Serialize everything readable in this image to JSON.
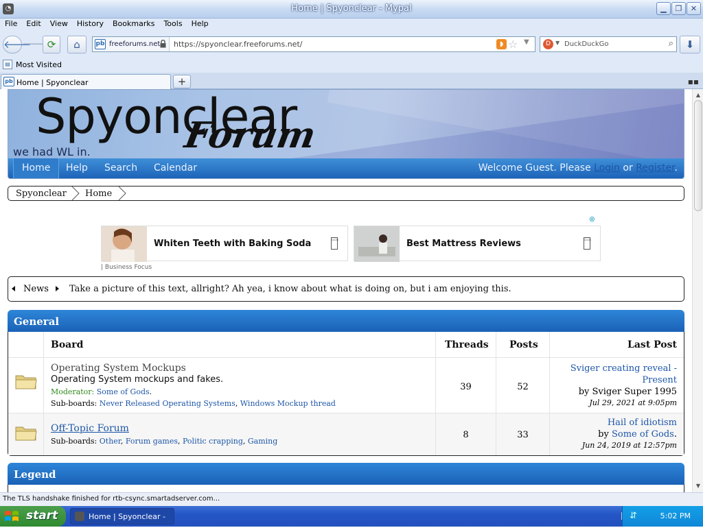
{
  "window": {
    "title": "Home | Spyonclear - Mypal",
    "controls": [
      "minimize",
      "restore",
      "close"
    ]
  },
  "menu": [
    "File",
    "Edit",
    "View",
    "History",
    "Bookmarks",
    "Tools",
    "Help"
  ],
  "toolbar": {
    "site_identity": "freeforums.net",
    "url": "https://spyonclear.freeforums.net/",
    "search_placeholder": "DuckDuckGo"
  },
  "bookmarks": {
    "item": "Most Visited"
  },
  "tabs": [
    {
      "label": "Home | Spyonclear"
    }
  ],
  "banner": {
    "logo": "Spyonclear",
    "logo_sub": "Forum",
    "tagline": "we had WL in.",
    "nav": [
      "Home",
      "Help",
      "Search",
      "Calendar"
    ],
    "welcome_prefix": "Welcome Guest. Please",
    "login": "Login",
    "or": "or",
    "register": "Register",
    "period": "."
  },
  "breadcrumb": [
    "Spyonclear",
    "Home"
  ],
  "ads": [
    {
      "title": "Whiten Teeth with Baking Soda"
    },
    {
      "title": "Best Mattress Reviews"
    }
  ],
  "ads_source": "| Business Focus",
  "news": {
    "label": "News",
    "text": "Take a picture of this text, allright? Ah yea, i know about what is doing on, but i am enjoying this."
  },
  "categories": {
    "general": {
      "title": "General",
      "headers": {
        "board": "Board",
        "threads": "Threads",
        "posts": "Posts",
        "last_post": "Last Post"
      },
      "boards": [
        {
          "name": "Operating System Mockups",
          "description": "Operating System mockups and fakes.",
          "moderator_label": "Moderator:",
          "moderator": "Some of Gods",
          "subboards_label": "Sub-boards:",
          "subboards": [
            "Never Released Operating Systems",
            "Windows Mockup thread"
          ],
          "threads": "39",
          "posts": "52",
          "last_post_title": "Sviger creating reveal - Present",
          "last_post_title_1": "Sviger creating reveal -",
          "last_post_title_2": "Present",
          "last_post_by": "by Sviger Super 1995",
          "last_post_date": "Jul 29, 2021 at 9:05pm"
        },
        {
          "name": "Off-Topic Forum",
          "subboards_label": "Sub-boards:",
          "subboards": [
            "Other",
            "Forum games",
            "Politic crapping",
            "Gaming"
          ],
          "threads": "8",
          "posts": "33",
          "last_post_title": "Hail of idiotism",
          "last_post_by_prefix": "by",
          "last_post_by": "Some of Gods",
          "last_post_date": "Jun 24, 2019 at 12:57pm"
        }
      ]
    },
    "legend": {
      "title": "Legend"
    }
  },
  "status_text": "The TLS handshake finished for rtb-csync.smartadserver.com...",
  "taskbar": {
    "start": "start",
    "task": "Home | Spyonclear - ...",
    "clock": "5:02 PM"
  },
  "colors": {
    "nav_blue": "#1d64b8",
    "link": "#1d56a8",
    "moderator_green": "#2e8a1a",
    "taskbar_blue": "#2456c6",
    "start_green": "#2f8a2f"
  }
}
